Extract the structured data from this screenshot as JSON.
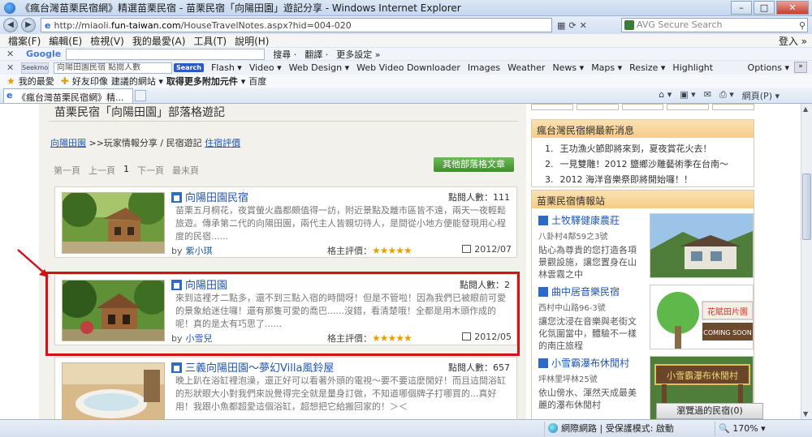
{
  "window": {
    "title": "《瘋台灣苗栗民宿網》精選苗栗民宿 - 苗栗民宿「向陽田園」遊記分享 - Windows Internet Explorer",
    "minimize": "–",
    "maximize": "□",
    "close": "✕"
  },
  "address": {
    "url_prefix": "http://miaoli.",
    "url_host": "fun-taiwan.com",
    "url_suffix": "/HouseTravelNotes.aspx?hid=004-020",
    "search_placeholder": "AVG Secure Search"
  },
  "menu": {
    "items": [
      "檔案(F)",
      "編輯(E)",
      "檢視(V)",
      "我的最愛(A)",
      "工具(T)",
      "說明(H)"
    ],
    "login": "登入 »"
  },
  "googlebar": {
    "close": "✕",
    "logo": "Google",
    "items": [
      "搜尋 ·",
      "翻譯 ·",
      "更多設定 »"
    ]
  },
  "linksbar": {
    "close": "✕",
    "brand": "Seekmo",
    "query": "向陽田園民宿  點閱人數",
    "search_btn": "Search",
    "items": [
      "Flash ▾",
      "Video ▾",
      "Web Design ▾",
      "Web Video Downloader",
      "Images",
      "Weather",
      "News ▾",
      "Maps ▾",
      "Resize ▾",
      "Highlight"
    ],
    "options": "Options ▾"
  },
  "favbar": {
    "items": [
      "我的最愛",
      "好友印像",
      "建議的網站 ▾",
      "取得更多附加元件 ▾",
      "百度"
    ]
  },
  "tabs": {
    "active": "《瘋台灣苗栗民宿網》精...",
    "page_menu": "網頁(P) ▾"
  },
  "page": {
    "title": "苗栗民宿「向陽田園」部落格遊記",
    "breadcrumb": {
      "root": "向陽田園",
      "middle": " >>玩家情報分享 / 民宿遊記  ",
      "current": "住宿評價"
    },
    "pager": {
      "first": "第一頁",
      "prev": "上一頁",
      "current": "1",
      "next": "下一頁",
      "last": "最末頁"
    },
    "other_button": "其他部落格文章",
    "views_label": "點閱人數：",
    "by_label": "by",
    "rating_label": "格主評價：",
    "stars": "★★★★★",
    "posts": [
      {
        "title": "向陽田園民宿",
        "views": "111",
        "desc": "苗栗五月桐花，夜賞螢火蟲都頗值得一訪，附近景點及離市區皆不遠，兩天一夜輕鬆旅遊。傳承第二代的向陽田園，兩代主人皆親切待人，是間從小地方便能發現用心程度的民宿......",
        "author": "紫小琪",
        "date": "2012/07"
      },
      {
        "title": "向陽田園",
        "views": "2",
        "desc": "來到這裡才二點多，還不到三點入宿的時間呀！但是不管啦！因為我們已被眼前可愛的景象給迷住囉！還有那隻可愛的喬巴......沒錯，看清楚哦！全都是用木頭作成的呢！真的是太有巧思了......",
        "author": "小雪兒",
        "date": "2012/05"
      },
      {
        "title": "三義向陽田園～夢幻Villa風鈴屋",
        "views": "657",
        "desc": "晚上趴在浴缸裡泡澡，還正好可以看著外頭的電視～要不要這麼閒好！而且這間浴缸的形狀眼大小對我們來說覺得完全就是量身訂做，不知道哪個牌子打哪買的...真好用！我跟小魚都超愛這個浴缸，超想把它給搬回家的！＞＜",
        "author": "",
        "date": ""
      }
    ]
  },
  "sidebar": {
    "news_title": "瘋台灣民宿網最新消息",
    "news": [
      {
        "num": "1.",
        "text": "王功漁火節即將來到，夏夜賞花火去！"
      },
      {
        "num": "2.",
        "text": "一見雙雕！2012 鹽鄉沙雕藝術季在台南～"
      },
      {
        "num": "3.",
        "text": "2012 海洋音樂祭即將開始囉！！"
      }
    ],
    "info_title": "苗栗民宿情報站",
    "bnbs": [
      {
        "name": "土牧驛健康農莊",
        "addr": "八卦村4鄰59之3號",
        "desc": "貼心為尊貴的您打造各項景觀設施，讓您置身在山林雲霧之中",
        "img_label": ""
      },
      {
        "name": "曲中居音樂民宿",
        "addr": "西村中山路96-3號",
        "desc": "讓您沈浸在音樂與老街文化氛圍當中，體驗不一樣的南庄旅程",
        "img_label": "花賦田片園 COMING SOON"
      },
      {
        "name": "小雪霸瀑布休閒村",
        "addr": "坪林里坪林25號",
        "desc": "依山傍水、渾然天成最美麗的瀑布休閒村",
        "img_label": "小雪霸瀑布休閒村"
      }
    ]
  },
  "status": {
    "viewed": "瀏覽過的民宿(0)",
    "zone": "網際網路 | 受保護模式: 啟動",
    "zoom": "170%"
  },
  "colors": {
    "highlight_border": "#d0121a",
    "link": "#2356b0",
    "green_button": "#4f9e3b",
    "sidebar_head": "#f6cc86"
  }
}
